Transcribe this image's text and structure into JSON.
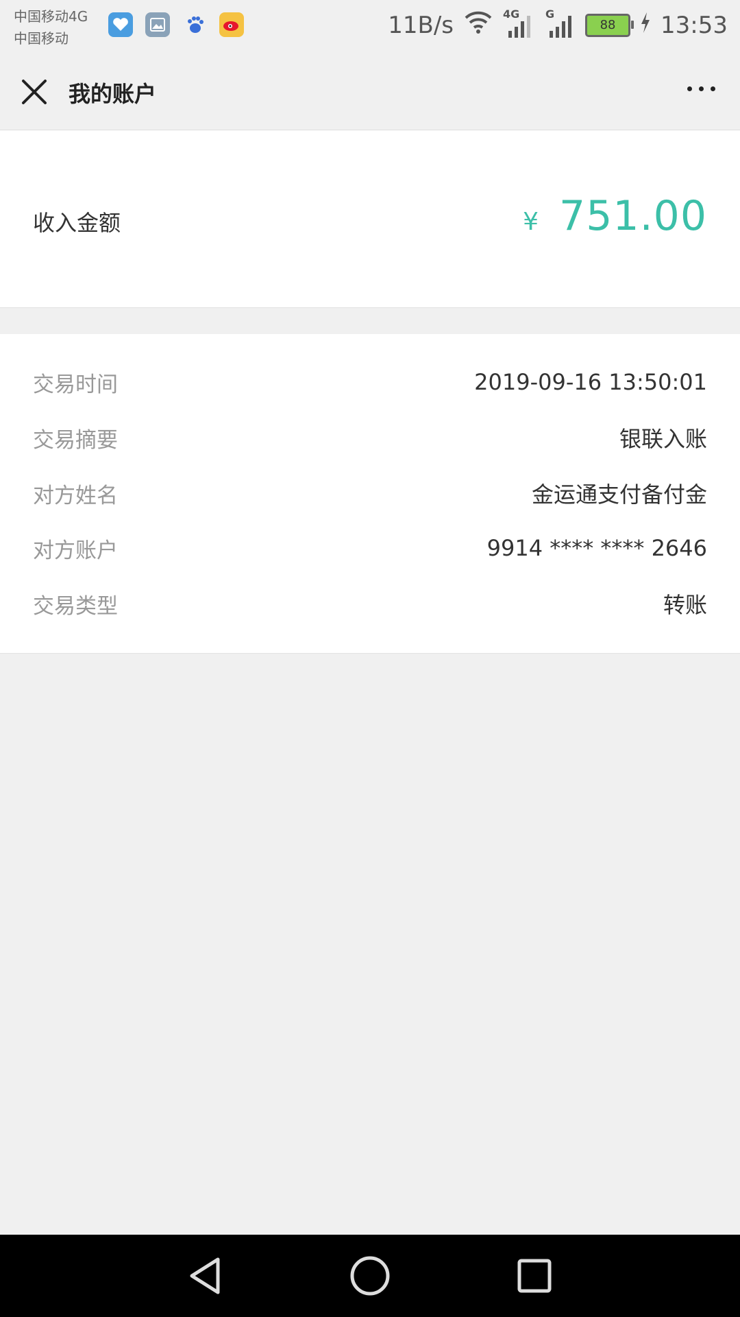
{
  "status_bar": {
    "carrier1": "中国移动4G",
    "carrier2": "中国移动",
    "net_speed": "11B/s",
    "signal1_label": "4G",
    "signal2_label": "G",
    "battery": "88",
    "time": "13:53",
    "app_icons": [
      "health-icon",
      "gallery-icon",
      "baidu-icon",
      "weibo-icon"
    ]
  },
  "header": {
    "title": "我的账户"
  },
  "amount": {
    "label": "收入金额",
    "currency": "¥",
    "value": "751.00",
    "color": "#3cbfa8"
  },
  "details": [
    {
      "label": "交易时间",
      "value": "2019-09-16  13:50:01"
    },
    {
      "label": "交易摘要",
      "value": "银联入账"
    },
    {
      "label": "对方姓名",
      "value": "金运通支付备付金"
    },
    {
      "label": "对方账户",
      "value": "9914 **** **** 2646"
    },
    {
      "label": "交易类型",
      "value": "转账"
    }
  ]
}
